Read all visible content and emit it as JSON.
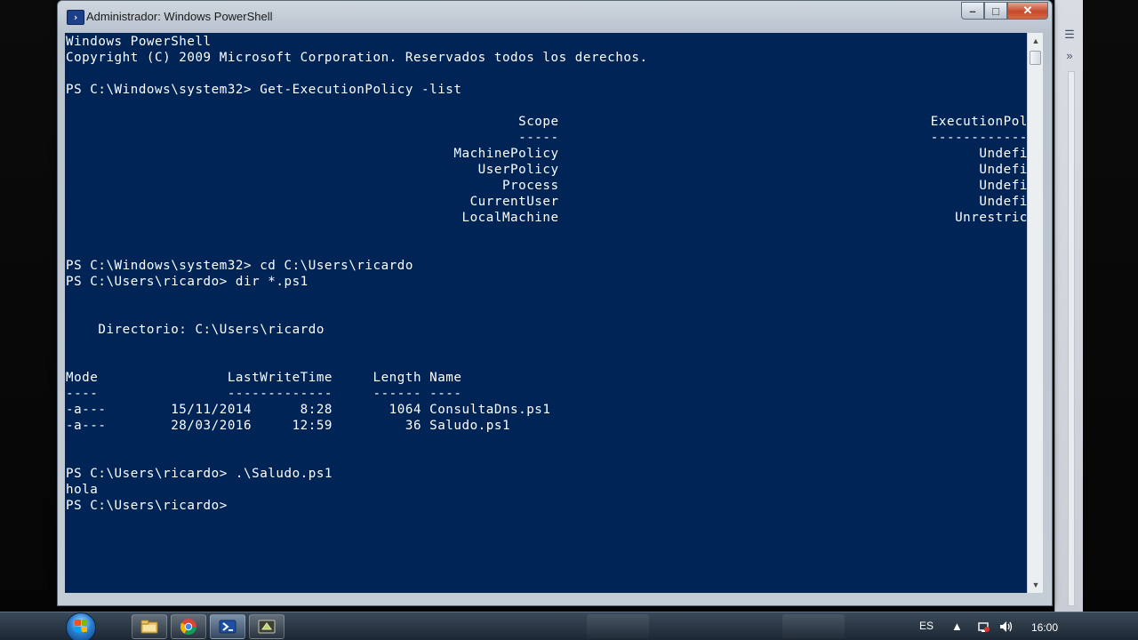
{
  "window": {
    "title": "Administrador: Windows PowerShell",
    "minimize_glyph": "–",
    "maximize_glyph": "□",
    "close_glyph": "✕"
  },
  "console": {
    "lines": [
      "Windows PowerShell",
      "Copyright (C) 2009 Microsoft Corporation. Reservados todos los derechos.",
      "",
      "PS C:\\Windows\\system32> Get-ExecutionPolicy -list",
      "",
      "                                                        Scope                                              ExecutionPolicy",
      "                                                        -----                                              ---------------",
      "                                                MachinePolicy                                                    Undefined",
      "                                                   UserPolicy                                                    Undefined",
      "                                                      Process                                                    Undefined",
      "                                                  CurrentUser                                                    Undefined",
      "                                                 LocalMachine                                                 Unrestricted",
      "",
      "",
      "PS C:\\Windows\\system32> cd C:\\Users\\ricardo",
      "PS C:\\Users\\ricardo> dir *.ps1",
      "",
      "",
      "    Directorio: C:\\Users\\ricardo",
      "",
      "",
      "Mode                LastWriteTime     Length Name",
      "----                -------------     ------ ----",
      "-a---        15/11/2014      8:28       1064 ConsultaDns.ps1",
      "-a---        28/03/2016     12:59         36 Saludo.ps1",
      "",
      "",
      "PS C:\\Users\\ricardo> .\\Saludo.ps1",
      "hola",
      "PS C:\\Users\\ricardo>"
    ]
  },
  "taskbar": {
    "items": [
      {
        "name": "explorer",
        "icon": "folder-icon"
      },
      {
        "name": "chrome",
        "icon": "chrome-icon"
      },
      {
        "name": "powershell",
        "icon": "powershell-icon"
      },
      {
        "name": "app",
        "icon": "app-icon"
      }
    ],
    "tray": {
      "language": "ES",
      "time": "16:00"
    }
  },
  "colors": {
    "console_bg": "#012456",
    "console_fg": "#ffffff"
  }
}
